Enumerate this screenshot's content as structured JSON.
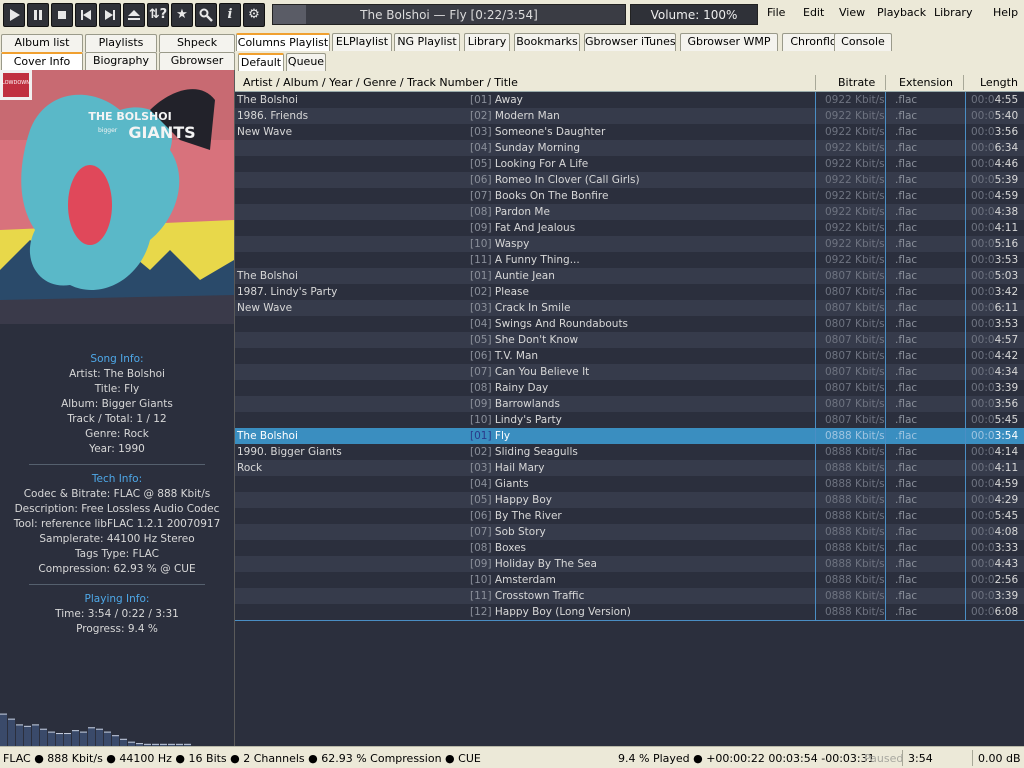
{
  "window": {
    "title_text": "The Bolshoi — Fly [0:22/3:54]",
    "volume": "Volume: 100%",
    "progress_fraction": 0.094
  },
  "toolbar": {
    "buttons": [
      "play",
      "pause",
      "stop",
      "previous",
      "next",
      "eject",
      "random",
      "favorite",
      "search",
      "info",
      "settings"
    ]
  },
  "menu": [
    "File",
    "Edit",
    "View",
    "Playback",
    "Library",
    "Help"
  ],
  "left_tabs_row1": [
    "Album list",
    "Playlists",
    "Shpeck"
  ],
  "left_tabs_row2": [
    "Cover Info",
    "Biography",
    "Gbrowser"
  ],
  "right_tabs_row1": [
    "Columns Playlist",
    "ELPlaylist",
    "NG Playlist",
    "Library",
    "Bookmarks",
    "Gbrowser iTunes",
    "Gbrowser WMP",
    "Chronflow",
    "Console"
  ],
  "right_tabs_row2": [
    "Default",
    "Queue"
  ],
  "cover": {
    "band": "THE BOLSHOI",
    "album": "GIANTS",
    "small": "bigger",
    "label": "LOWDOWN"
  },
  "song_info": {
    "heading": "Song Info:",
    "artist": "Artist: The Bolshoi",
    "title": "Title: Fly",
    "album": "Album: Bigger Giants",
    "track": "Track / Total: 1 / 12",
    "genre": "Genre: Rock",
    "year": "Year: 1990"
  },
  "tech_info": {
    "heading": "Tech Info:",
    "codec": "Codec & Bitrate: FLAC @ 888 Kbit/s",
    "description": "Description: Free Lossless Audio Codec",
    "tool": "Tool: reference libFLAC 1.2.1 20070917",
    "samplerate": "Samplerate: 44100 Hz Stereo",
    "tags": "Tags Type: FLAC",
    "compression": "Compression: 62.93 % @ CUE"
  },
  "playing_info": {
    "heading": "Playing Info:",
    "time": "Time: 3:54 / 0:22 / 3:31",
    "progress": "Progress: 9.4 %"
  },
  "visualizer": {
    "levels": [
      0.45,
      0.38,
      0.3,
      0.28,
      0.3,
      0.24,
      0.2,
      0.18,
      0.18,
      0.22,
      0.2,
      0.26,
      0.24,
      0.2,
      0.15,
      0.1,
      0.06,
      0.04,
      0.03,
      0.03,
      0.03,
      0.03,
      0.03,
      0.03
    ]
  },
  "columns": {
    "main": "Artist / Album / Year / Genre / Track Number / Title",
    "bitrate": "Bitrate",
    "extension": "Extension",
    "length": "Length"
  },
  "groups": [
    {
      "artist": "The Bolshoi",
      "album_year": "1986. Friends",
      "genre": "New Wave",
      "bitrate": "0922 Kbit/s",
      "tracks": [
        {
          "num": "[01]",
          "title": "Away",
          "len_prefix": "00:0",
          "len": "4:55"
        },
        {
          "num": "[02]",
          "title": "Modern Man",
          "len_prefix": "00:0",
          "len": "5:40"
        },
        {
          "num": "[03]",
          "title": "Someone's Daughter",
          "len_prefix": "00:0",
          "len": "3:56"
        },
        {
          "num": "[04]",
          "title": "Sunday Morning",
          "len_prefix": "00:0",
          "len": "6:34"
        },
        {
          "num": "[05]",
          "title": "Looking For A Life",
          "len_prefix": "00:0",
          "len": "4:46"
        },
        {
          "num": "[06]",
          "title": "Romeo In Clover (Call Girls)",
          "len_prefix": "00:0",
          "len": "5:39"
        },
        {
          "num": "[07]",
          "title": "Books On The Bonfire",
          "len_prefix": "00:0",
          "len": "4:59"
        },
        {
          "num": "[08]",
          "title": "Pardon Me",
          "len_prefix": "00:0",
          "len": "4:38"
        },
        {
          "num": "[09]",
          "title": "Fat And Jealous",
          "len_prefix": "00:0",
          "len": "4:11"
        },
        {
          "num": "[10]",
          "title": "Waspy",
          "len_prefix": "00:0",
          "len": "5:16"
        },
        {
          "num": "[11]",
          "title": "A Funny Thing...",
          "len_prefix": "00:0",
          "len": "3:53"
        }
      ]
    },
    {
      "artist": "The Bolshoi",
      "album_year": "1987. Lindy's Party",
      "genre": "New Wave",
      "bitrate": "0807 Kbit/s",
      "tracks": [
        {
          "num": "[01]",
          "title": "Auntie Jean",
          "len_prefix": "00:0",
          "len": "5:03"
        },
        {
          "num": "[02]",
          "title": "Please",
          "len_prefix": "00:0",
          "len": "3:42"
        },
        {
          "num": "[03]",
          "title": "Crack In Smile",
          "len_prefix": "00:0",
          "len": "6:11"
        },
        {
          "num": "[04]",
          "title": "Swings And Roundabouts",
          "len_prefix": "00:0",
          "len": "3:53"
        },
        {
          "num": "[05]",
          "title": "She Don't Know",
          "len_prefix": "00:0",
          "len": "4:57"
        },
        {
          "num": "[06]",
          "title": "T.V. Man",
          "len_prefix": "00:0",
          "len": "4:42"
        },
        {
          "num": "[07]",
          "title": "Can You Believe It",
          "len_prefix": "00:0",
          "len": "4:34"
        },
        {
          "num": "[08]",
          "title": "Rainy Day",
          "len_prefix": "00:0",
          "len": "3:39"
        },
        {
          "num": "[09]",
          "title": "Barrowlands",
          "len_prefix": "00:0",
          "len": "3:56"
        },
        {
          "num": "[10]",
          "title": "Lindy's Party",
          "len_prefix": "00:0",
          "len": "5:45"
        }
      ]
    },
    {
      "artist": "The Bolshoi",
      "album_year": "1990. Bigger Giants",
      "genre": "Rock",
      "bitrate": "0888 Kbit/s",
      "tracks": [
        {
          "num": "[01]",
          "title": "Fly",
          "len_prefix": "00:0",
          "len": "3:54"
        },
        {
          "num": "[02]",
          "title": "Sliding Seagulls",
          "len_prefix": "00:0",
          "len": "4:14"
        },
        {
          "num": "[03]",
          "title": "Hail Mary",
          "len_prefix": "00:0",
          "len": "4:11"
        },
        {
          "num": "[04]",
          "title": "Giants",
          "len_prefix": "00:0",
          "len": "4:59"
        },
        {
          "num": "[05]",
          "title": "Happy Boy",
          "len_prefix": "00:0",
          "len": "4:29"
        },
        {
          "num": "[06]",
          "title": "By The River",
          "len_prefix": "00:0",
          "len": "5:45"
        },
        {
          "num": "[07]",
          "title": "Sob Story",
          "len_prefix": "00:0",
          "len": "4:08"
        },
        {
          "num": "[08]",
          "title": "Boxes",
          "len_prefix": "00:0",
          "len": "3:33"
        },
        {
          "num": "[09]",
          "title": "Holiday By The Sea",
          "len_prefix": "00:0",
          "len": "4:43"
        },
        {
          "num": "[10]",
          "title": "Amsterdam",
          "len_prefix": "00:0",
          "len": "2:56"
        },
        {
          "num": "[11]",
          "title": "Crosstown Traffic",
          "len_prefix": "00:0",
          "len": "3:39"
        },
        {
          "num": "[12]",
          "title": "Happy Boy (Long Version)",
          "len_prefix": "00:0",
          "len": "6:08"
        }
      ]
    }
  ],
  "extension": ".flac",
  "selected": {
    "group": 2,
    "track": 0
  },
  "statusbar": {
    "left": "FLAC ● 888 Kbit/s ● 44100 Hz ● 16 Bits ● 2 Channels ● 62.93 % Compression ● CUE",
    "played": "9.4 % Played ● +00:00:22  00:03:54  -00:03:31",
    "paused": "Paused",
    "time": "3:54",
    "db": "0.00 dB"
  },
  "colors": {
    "accent": "#3a8ec0",
    "panel_bg": "#2b2f3d",
    "heading": "#4ea8e8",
    "row_alt": "#363b4b"
  }
}
